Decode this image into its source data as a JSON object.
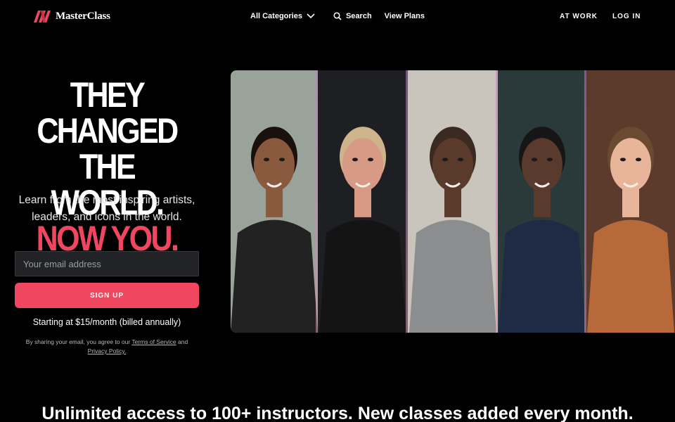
{
  "brand": {
    "name": "MasterClass",
    "accent": "#f0465f"
  },
  "nav": {
    "categories_label": "All Categories",
    "search_label": "Search",
    "plans_label": "View Plans",
    "at_work_label": "AT WORK",
    "login_label": "LOG IN"
  },
  "hero": {
    "headline_line1": "THEY CHANGED",
    "headline_line2": "THE WORLD.",
    "headline_line3": "NOW YOU.",
    "subtitle": "Learn from the most inspiring artists, leaders, and icons in the world.",
    "email_placeholder": "Your email address",
    "signup_label": "SIGN UP",
    "pricing": "Starting at $15/month (billed annually)",
    "legal_prefix": "By sharing your email, you agree to our",
    "terms_link": "Terms of Service",
    "legal_and": "and",
    "privacy_link": "Privacy Policy."
  },
  "instructor_strips": [
    {
      "name": "instructor-strip-1",
      "bg": "#9aa39a",
      "skin": "#8a5a3e",
      "hair": "#1a100c",
      "shirt": "#222"
    },
    {
      "name": "instructor-strip-2",
      "bg": "#1e1f22",
      "skin": "#d79a84",
      "hair": "#cdb48a",
      "shirt": "#141414"
    },
    {
      "name": "instructor-strip-3",
      "bg": "#c9c5bd",
      "skin": "#5a3a2a",
      "hair": "#3a2a22",
      "shirt": "#8c8d8f"
    },
    {
      "name": "instructor-strip-4",
      "bg": "#2a3a3a",
      "skin": "#5a3a2c",
      "hair": "#161616",
      "shirt": "#1f2a44"
    },
    {
      "name": "instructor-strip-5",
      "bg": "#5c3a2c",
      "skin": "#e8b59a",
      "hair": "#6b4a32",
      "shirt": "#b8693a"
    }
  ],
  "bottom": {
    "headline": "Unlimited access to 100+ instructors. New classes added every month."
  }
}
